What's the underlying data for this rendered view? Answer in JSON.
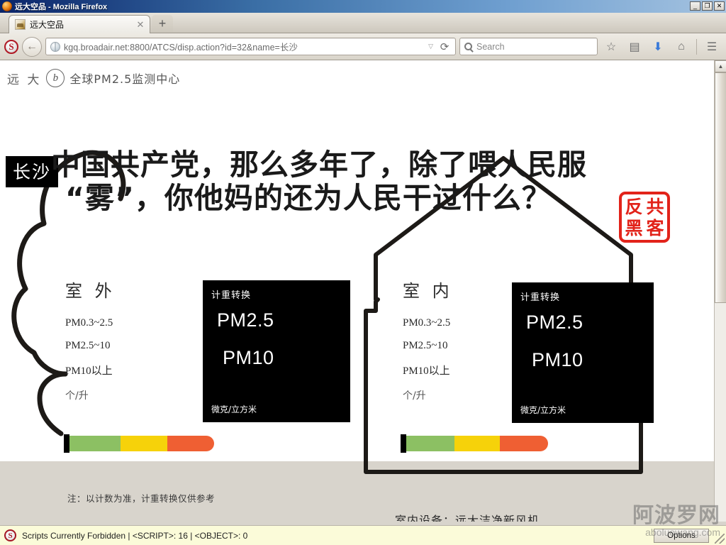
{
  "window": {
    "title": "远大空品 - Mozilla Firefox",
    "minimize_label": "_",
    "maximize_label": "❐",
    "close_label": "✕"
  },
  "tabs": [
    {
      "title": "远大空品",
      "favicon": "page-favicon",
      "close_label": "✕"
    }
  ],
  "newtab_label": "+",
  "toolbar": {
    "noscript_icon_label": "S",
    "back_label": "←",
    "url": "kgq.broadair.net:8800/ATCS/disp.action?id=32&name=长沙",
    "url_dropdown_label": "▽",
    "reload_label": "⟳",
    "search_placeholder": "Search",
    "bookmark_icon": "☆",
    "library_icon": "▤",
    "download_icon": "⬇",
    "home_icon": "⌂",
    "menu_icon": "☰"
  },
  "page": {
    "site_brand": "远 大",
    "site_logo_glyph": "b",
    "site_subtitle": "全球PM2.5监测中心",
    "city_badge": "长沙",
    "deface": {
      "line1": "中国共产党，那么多年了，除了喂人民服",
      "line2": "“雾”，你他妈的还为人民干过什么？"
    },
    "stamp": {
      "c1": "反",
      "c2": "共",
      "c3": "黑",
      "c4": "客"
    },
    "outdoor": {
      "title": "室 外",
      "rows": [
        "PM0.3~2.5",
        "PM2.5~10",
        "PM10以上"
      ],
      "unit": "个/升",
      "blackbox": {
        "head": "计重转换",
        "value1": "PM2.5",
        "value2": "PM10",
        "foot": "微克/立方米"
      }
    },
    "indoor": {
      "title": "室 内",
      "rows": [
        "PM0.3~2.5",
        "PM2.5~10",
        "PM10以上"
      ],
      "unit": "个/升",
      "blackbox": {
        "head": "计重转换",
        "value1": "PM2.5",
        "value2": "PM10",
        "foot": "微克/立方米"
      }
    },
    "note": "注：以计数为准，计重转换仅供参考",
    "device_note": "室内设备：远大洁净新风机",
    "gauge_colors": {
      "green": "#8cc063",
      "yellow": "#f6d20a",
      "red": "#ef5f33",
      "marker": "#000000"
    }
  },
  "statusbar": {
    "icon_label": "S",
    "text": "Scripts Currently Forbidden | <SCRIPT>: 16 | <OBJECT>: 0",
    "options_label": "Options"
  },
  "watermark": {
    "cn": "阿波罗网",
    "en": "aboluowang.com"
  },
  "scrollbar": {
    "up_label": "▲",
    "down_label": "▼"
  }
}
